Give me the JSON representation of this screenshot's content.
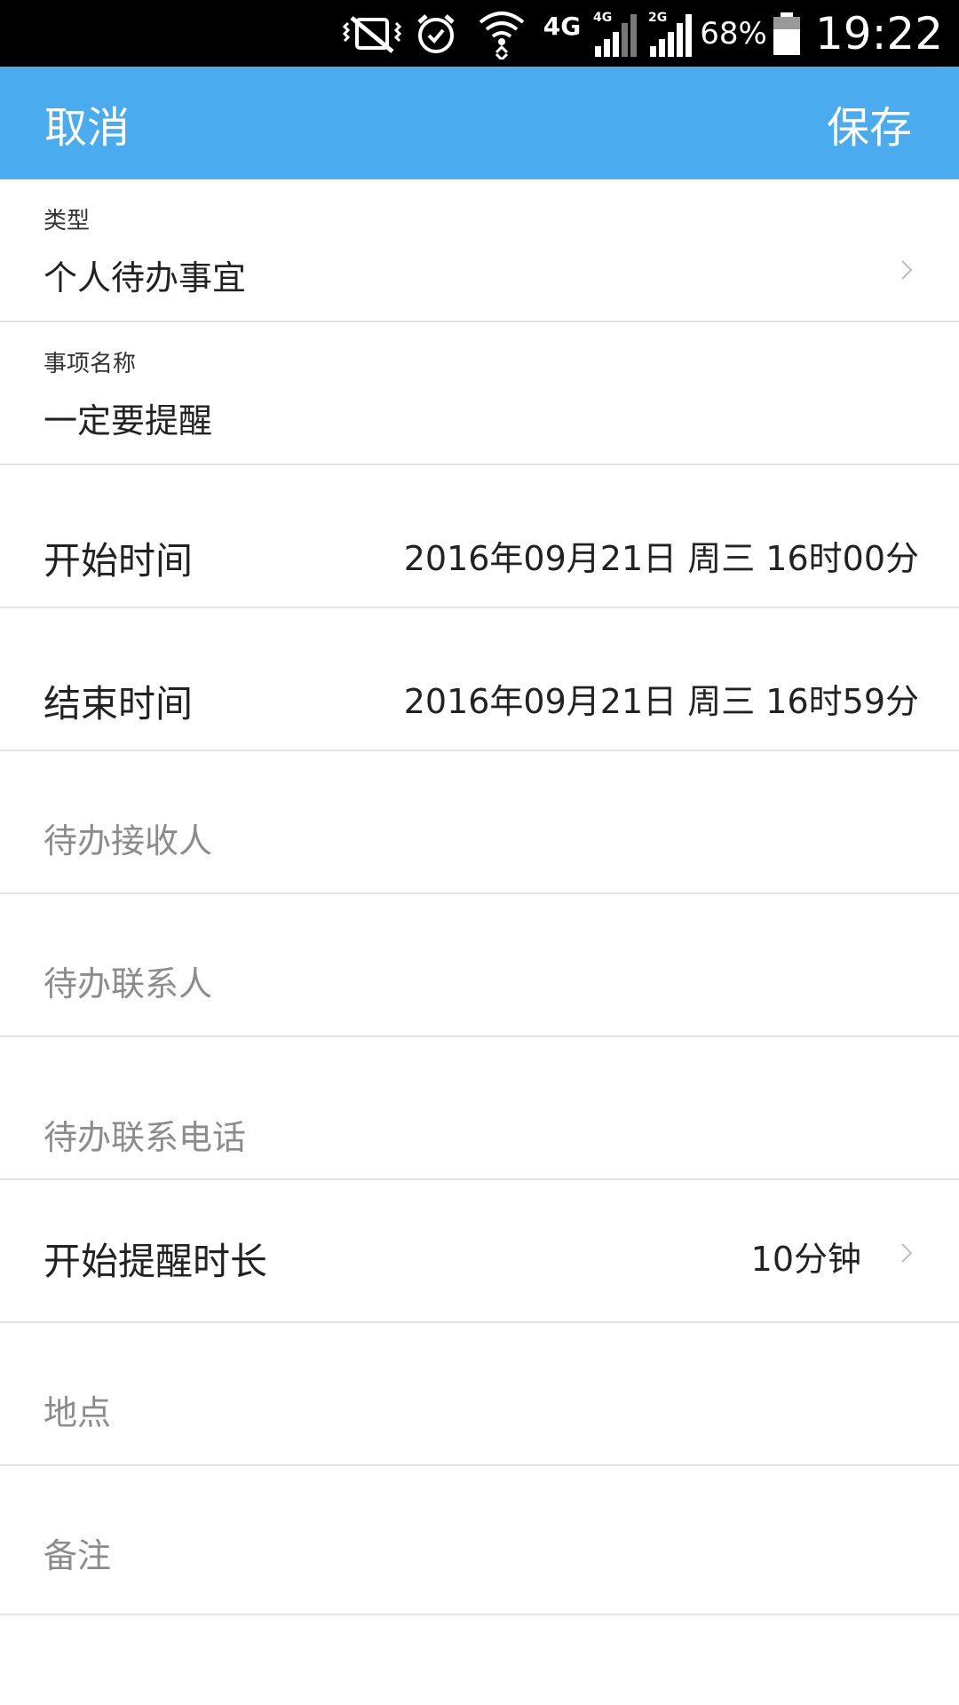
{
  "status_bar": {
    "network": "4G",
    "signal1_tag": "4G",
    "signal2_tag": "2G",
    "battery": "68%",
    "time": "19:22",
    "icons": [
      "mute-vibrate-icon",
      "alarm-icon",
      "wifi-icon",
      "signal-icon",
      "signal-icon",
      "battery-icon"
    ]
  },
  "appbar": {
    "cancel_label": "取消",
    "save_label": "保存",
    "background": "#4aabee"
  },
  "form": {
    "type": {
      "label": "类型",
      "value": "个人待办事宜"
    },
    "item_name": {
      "label": "事项名称",
      "value": "一定要提醒"
    },
    "start_time": {
      "label": "开始时间",
      "value": "2016年09月21日 周三 16时00分"
    },
    "end_time": {
      "label": "结束时间",
      "value": "2016年09月21日 周三 16时59分"
    },
    "receiver": {
      "placeholder": "待办接收人"
    },
    "contact": {
      "placeholder": "待办联系人"
    },
    "phone": {
      "placeholder": "待办联系电话"
    },
    "reminder": {
      "label": "开始提醒时长",
      "value": "10分钟"
    },
    "location": {
      "placeholder": "地点"
    },
    "remark": {
      "placeholder": "备注"
    }
  }
}
